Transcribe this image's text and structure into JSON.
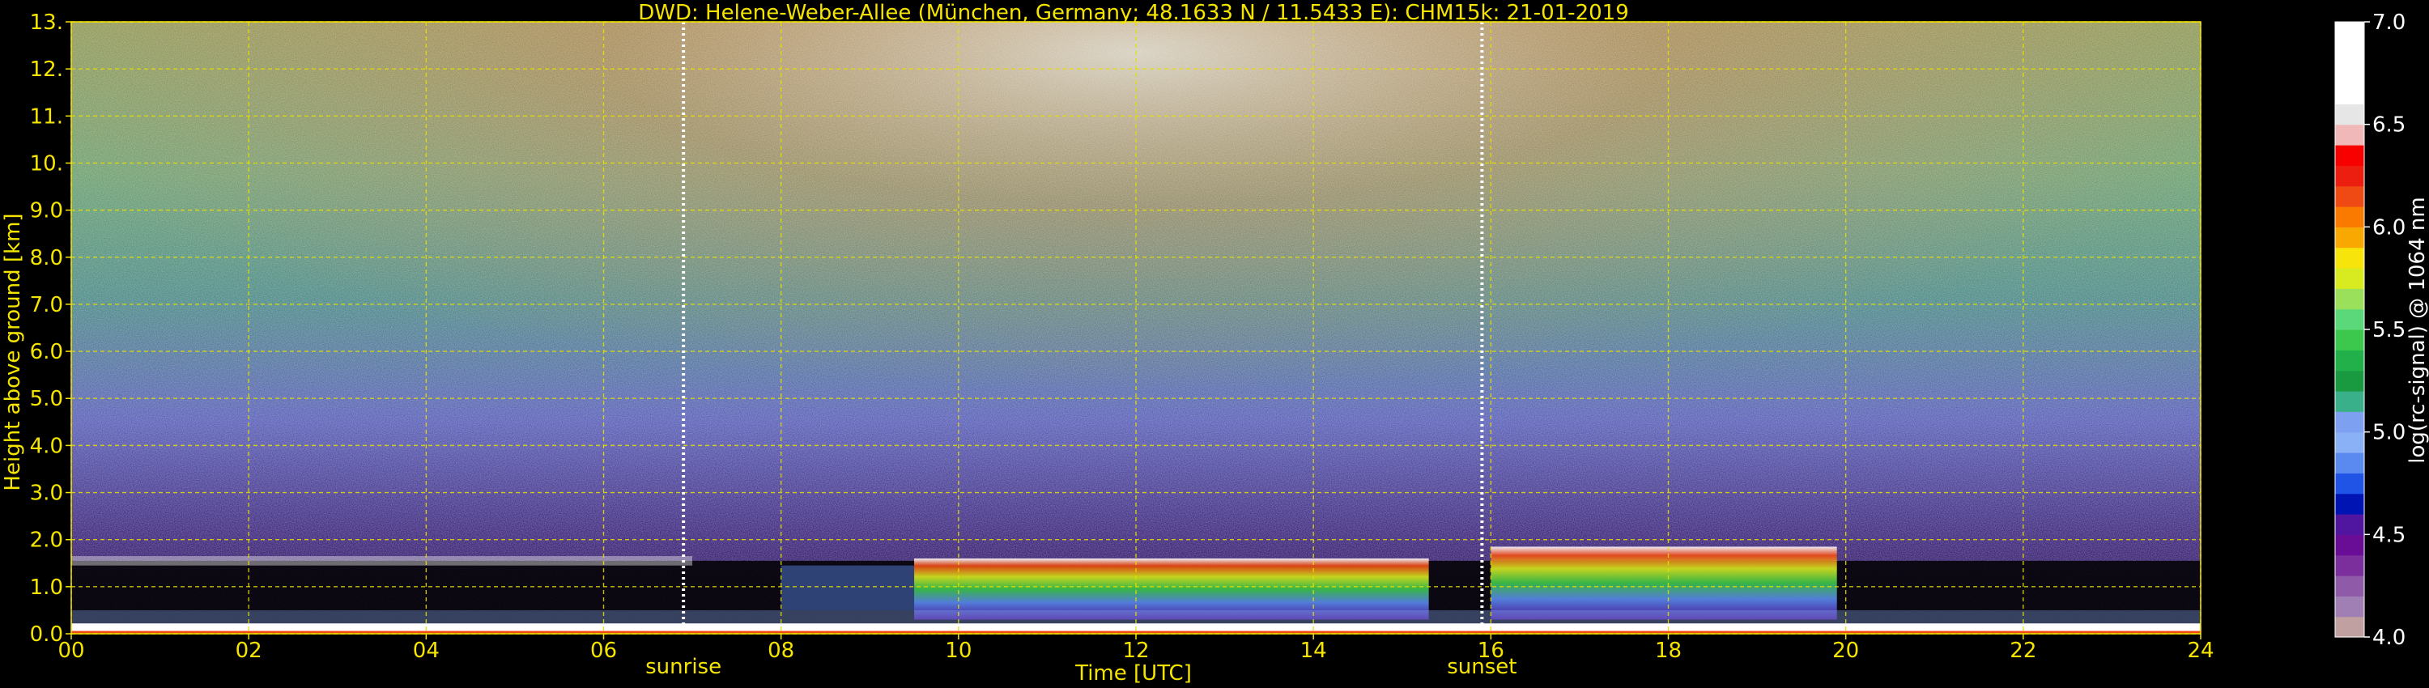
{
  "chart_data": {
    "type": "heatmap",
    "title": "DWD: Helene-Weber-Allee (München, Germany; 48.1633 N / 11.5433 E):    CHM15k: 21-01-2019",
    "xlabel": "Time [UTC]",
    "ylabel": "Height above ground [km]",
    "xlim": [
      0,
      24
    ],
    "ylim": [
      0,
      13
    ],
    "x_ticks": [
      0,
      2,
      4,
      6,
      8,
      10,
      12,
      14,
      16,
      18,
      20,
      22,
      24
    ],
    "x_tick_labels": [
      "00",
      "02",
      "04",
      "06",
      "08",
      "10",
      "12",
      "14",
      "16",
      "18",
      "20",
      "22",
      "24"
    ],
    "y_ticks": [
      0,
      1,
      2,
      3,
      4,
      5,
      6,
      7,
      8,
      9,
      10,
      11,
      12,
      13
    ],
    "y_tick_labels": [
      "0.0",
      "1.0",
      "2.0",
      "3.0",
      "4.0",
      "5.0",
      "6.0",
      "7.0",
      "8.0",
      "9.0",
      "10.",
      "11.",
      "12.",
      "13."
    ],
    "grid": true,
    "grid_color": "#e6e000",
    "markers": [
      {
        "label": "sunrise",
        "x": 6.9
      },
      {
        "label": "sunset",
        "x": 15.9
      }
    ],
    "colorbar": {
      "label": "log(rc-signal) @ 1064 nm",
      "min": 4.0,
      "max": 7.0,
      "ticks": [
        4.0,
        4.5,
        5.0,
        5.5,
        6.0,
        6.5,
        7.0
      ],
      "tick_labels": [
        "4.0",
        "4.5",
        "5.0",
        "5.5",
        "6.0",
        "6.5",
        "7.0"
      ],
      "colors": [
        "#c0a0a0",
        "#9f7fb4",
        "#8f5aa8",
        "#7b2f9c",
        "#6a0d96",
        "#5016a0",
        "#0014b4",
        "#1f54e6",
        "#5a8af0",
        "#8ab0f5",
        "#7ea0f0",
        "#3ab08a",
        "#1a9a40",
        "#22b04a",
        "#3cc84c",
        "#5ad87a",
        "#9ae05a",
        "#d8ea20",
        "#f6e40a",
        "#f8a800",
        "#fa7a00",
        "#f04a14",
        "#ec1e10",
        "#f80000",
        "#f0b8b8",
        "#e6e6e6",
        "#ffffff",
        "#ffffff",
        "#ffffff",
        "#ffffff"
      ]
    }
  }
}
